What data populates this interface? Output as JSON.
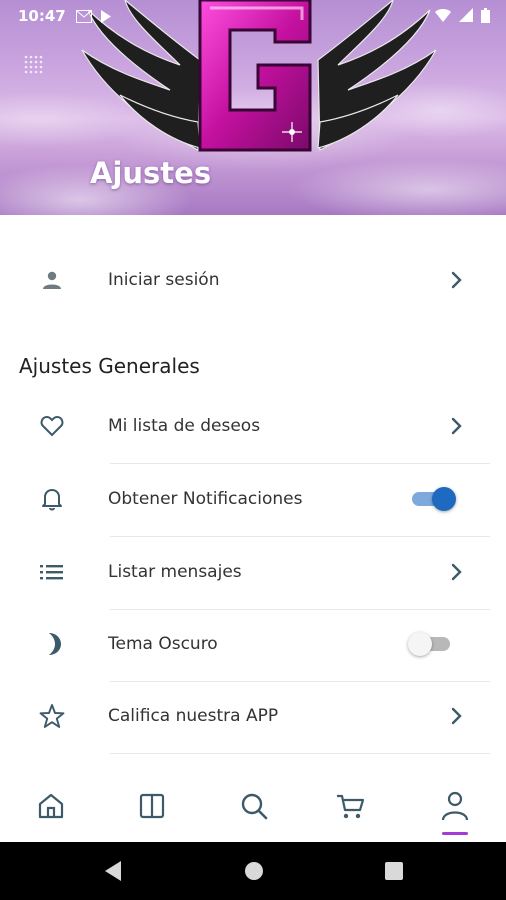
{
  "status_bar": {
    "time": "10:47",
    "icons": [
      "gmail-icon",
      "play-store-icon",
      "wifi-icon",
      "signal-icon",
      "battery-icon"
    ]
  },
  "header": {
    "title": "Ajustes",
    "logo_letter": "G",
    "icons": [
      "grid-menu-icon"
    ]
  },
  "account": {
    "login_label": "Iniciar sesión",
    "icon": "person-icon"
  },
  "general_settings": {
    "title": "Ajustes Generales",
    "items": [
      {
        "label": "Mi lista de deseos",
        "icon": "heart-icon",
        "control": "chevron"
      },
      {
        "label": "Obtener Notificaciones",
        "icon": "bell-icon",
        "control": "toggle",
        "enabled": true
      },
      {
        "label": "Listar mensajes",
        "icon": "list-icon",
        "control": "chevron"
      },
      {
        "label": "Tema Oscuro",
        "icon": "moon-icon",
        "control": "toggle",
        "enabled": false
      },
      {
        "label": "Califica nuestra APP",
        "icon": "star-icon",
        "control": "chevron"
      }
    ]
  },
  "bottom_nav": {
    "items": [
      "home-icon",
      "catalog-icon",
      "search-icon",
      "cart-icon",
      "account-icon"
    ],
    "active": "account-icon"
  },
  "colors": {
    "accent": "#a33bd6",
    "icon": "#3d5a6a",
    "toggle_on": "#1e6ac0",
    "text": "#333333"
  }
}
